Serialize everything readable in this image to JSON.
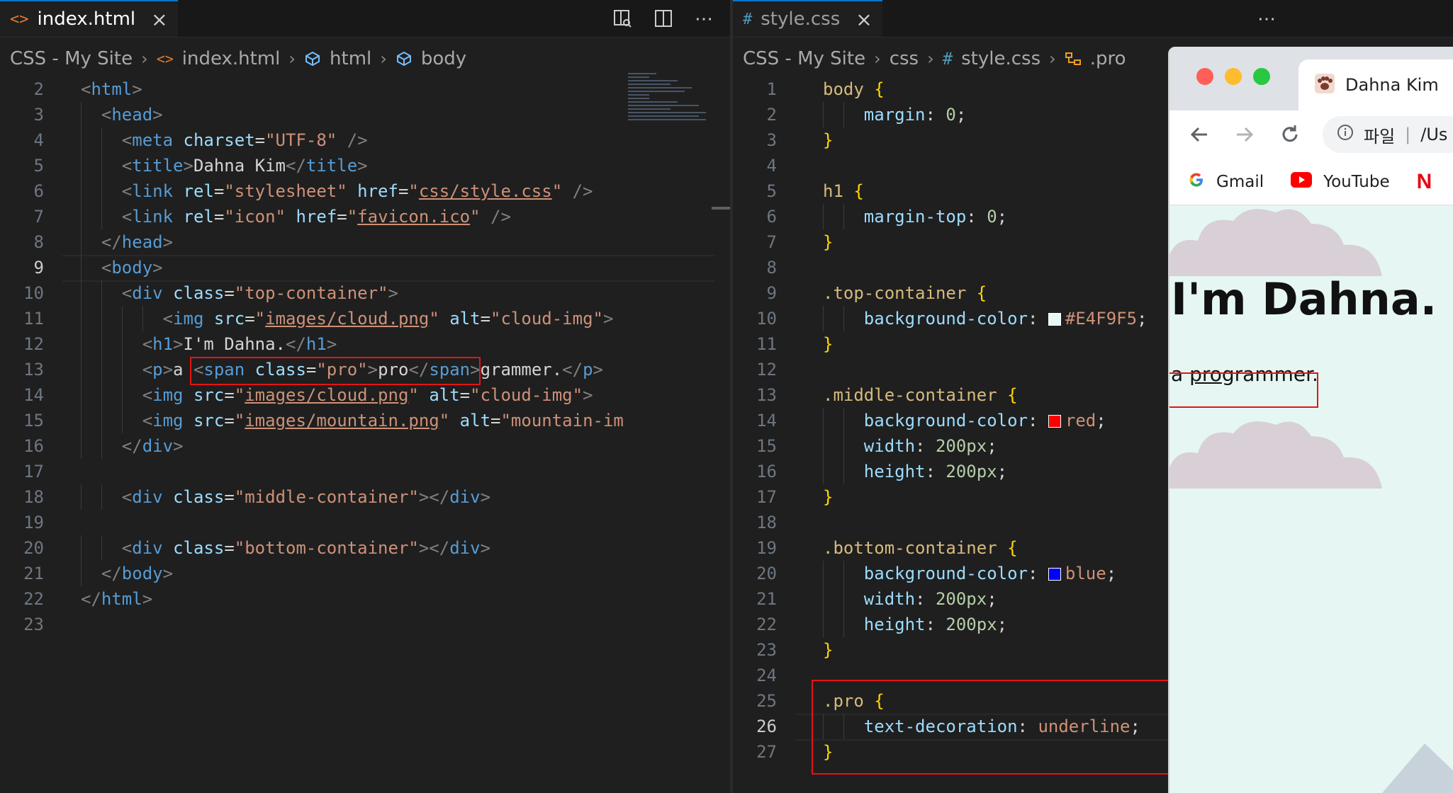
{
  "left_editor": {
    "tab": {
      "icon": "<>",
      "label": "index.html"
    },
    "breadcrumb": [
      "CSS - My Site",
      "index.html",
      "html",
      "body"
    ],
    "current_line": "9",
    "lines": [
      {
        "n": "2",
        "indent": 0,
        "tokens": [
          [
            "br",
            "<"
          ],
          [
            "tag",
            "html"
          ],
          [
            "br",
            ">"
          ]
        ]
      },
      {
        "n": "3",
        "indent": 1,
        "tokens": [
          [
            "br",
            "<"
          ],
          [
            "tag",
            "head"
          ],
          [
            "br",
            ">"
          ]
        ]
      },
      {
        "n": "4",
        "indent": 2,
        "tokens": [
          [
            "br",
            "<"
          ],
          [
            "tag",
            "meta"
          ],
          [
            "txt",
            " "
          ],
          [
            "attr",
            "charset"
          ],
          [
            "txt",
            "="
          ],
          [
            "str",
            "\"UTF-8\""
          ],
          [
            "txt",
            " "
          ],
          [
            "br",
            "/>"
          ]
        ]
      },
      {
        "n": "5",
        "indent": 2,
        "tokens": [
          [
            "br",
            "<"
          ],
          [
            "tag",
            "title"
          ],
          [
            "br",
            ">"
          ],
          [
            "txt",
            "Dahna Kim"
          ],
          [
            "br",
            "</"
          ],
          [
            "tag",
            "title"
          ],
          [
            "br",
            ">"
          ]
        ]
      },
      {
        "n": "6",
        "indent": 2,
        "tokens": [
          [
            "br",
            "<"
          ],
          [
            "tag",
            "link"
          ],
          [
            "txt",
            " "
          ],
          [
            "attr",
            "rel"
          ],
          [
            "txt",
            "="
          ],
          [
            "str",
            "\"stylesheet\""
          ],
          [
            "txt",
            " "
          ],
          [
            "attr",
            "href"
          ],
          [
            "txt",
            "="
          ],
          [
            "str",
            "\""
          ],
          [
            "link",
            "css/style.css"
          ],
          [
            "str",
            "\""
          ],
          [
            "txt",
            " "
          ],
          [
            "br",
            "/>"
          ]
        ]
      },
      {
        "n": "7",
        "indent": 2,
        "tokens": [
          [
            "br",
            "<"
          ],
          [
            "tag",
            "link"
          ],
          [
            "txt",
            " "
          ],
          [
            "attr",
            "rel"
          ],
          [
            "txt",
            "="
          ],
          [
            "str",
            "\"icon\""
          ],
          [
            "txt",
            " "
          ],
          [
            "attr",
            "href"
          ],
          [
            "txt",
            "="
          ],
          [
            "str",
            "\""
          ],
          [
            "link",
            "favicon.ico"
          ],
          [
            "str",
            "\""
          ],
          [
            "txt",
            " "
          ],
          [
            "br",
            "/>"
          ]
        ]
      },
      {
        "n": "8",
        "indent": 1,
        "tokens": [
          [
            "br",
            "</"
          ],
          [
            "tag",
            "head"
          ],
          [
            "br",
            ">"
          ]
        ]
      },
      {
        "n": "9",
        "indent": 1,
        "tokens": [
          [
            "br",
            "<"
          ],
          [
            "tag",
            "body"
          ],
          [
            "br",
            ">"
          ]
        ]
      },
      {
        "n": "10",
        "indent": 2,
        "tokens": [
          [
            "br",
            "<"
          ],
          [
            "tag",
            "div"
          ],
          [
            "txt",
            " "
          ],
          [
            "attr",
            "class"
          ],
          [
            "txt",
            "="
          ],
          [
            "str",
            "\"top-container\""
          ],
          [
            "br",
            ">"
          ]
        ]
      },
      {
        "n": "11",
        "indent": 4,
        "tokens": [
          [
            "br",
            "<"
          ],
          [
            "tag",
            "img"
          ],
          [
            "txt",
            " "
          ],
          [
            "attr",
            "src"
          ],
          [
            "txt",
            "="
          ],
          [
            "str",
            "\""
          ],
          [
            "link",
            "images/cloud.png"
          ],
          [
            "str",
            "\""
          ],
          [
            "txt",
            " "
          ],
          [
            "attr",
            "alt"
          ],
          [
            "txt",
            "="
          ],
          [
            "str",
            "\"cloud-img\""
          ],
          [
            "br",
            ">"
          ]
        ]
      },
      {
        "n": "12",
        "indent": 3,
        "tokens": [
          [
            "br",
            "<"
          ],
          [
            "tag",
            "h1"
          ],
          [
            "br",
            ">"
          ],
          [
            "txt",
            "I'm Dahna."
          ],
          [
            "br",
            "</"
          ],
          [
            "tag",
            "h1"
          ],
          [
            "br",
            ">"
          ]
        ]
      },
      {
        "n": "13",
        "indent": 3,
        "tokens": [
          [
            "br",
            "<"
          ],
          [
            "tag",
            "p"
          ],
          [
            "br",
            ">"
          ],
          [
            "txt",
            "a "
          ],
          [
            "br",
            "<"
          ],
          [
            "tag",
            "span"
          ],
          [
            "txt",
            " "
          ],
          [
            "attr",
            "class"
          ],
          [
            "txt",
            "="
          ],
          [
            "str",
            "\"pro\""
          ],
          [
            "br",
            ">"
          ],
          [
            "txt",
            "pro"
          ],
          [
            "br",
            "</"
          ],
          [
            "tag",
            "span"
          ],
          [
            "br",
            ">"
          ],
          [
            "txt",
            "grammer."
          ],
          [
            "br",
            "</"
          ],
          [
            "tag",
            "p"
          ],
          [
            "br",
            ">"
          ]
        ]
      },
      {
        "n": "14",
        "indent": 3,
        "tokens": [
          [
            "br",
            "<"
          ],
          [
            "tag",
            "img"
          ],
          [
            "txt",
            " "
          ],
          [
            "attr",
            "src"
          ],
          [
            "txt",
            "="
          ],
          [
            "str",
            "\""
          ],
          [
            "link",
            "images/cloud.png"
          ],
          [
            "str",
            "\""
          ],
          [
            "txt",
            " "
          ],
          [
            "attr",
            "alt"
          ],
          [
            "txt",
            "="
          ],
          [
            "str",
            "\"cloud-img\""
          ],
          [
            "br",
            ">"
          ]
        ]
      },
      {
        "n": "15",
        "indent": 3,
        "tokens": [
          [
            "br",
            "<"
          ],
          [
            "tag",
            "img"
          ],
          [
            "txt",
            " "
          ],
          [
            "attr",
            "src"
          ],
          [
            "txt",
            "="
          ],
          [
            "str",
            "\""
          ],
          [
            "link",
            "images/mountain.png"
          ],
          [
            "str",
            "\""
          ],
          [
            "txt",
            " "
          ],
          [
            "attr",
            "alt"
          ],
          [
            "txt",
            "="
          ],
          [
            "str",
            "\"mountain-im"
          ]
        ]
      },
      {
        "n": "16",
        "indent": 2,
        "tokens": [
          [
            "br",
            "</"
          ],
          [
            "tag",
            "div"
          ],
          [
            "br",
            ">"
          ]
        ]
      },
      {
        "n": "17",
        "indent": 0,
        "tokens": []
      },
      {
        "n": "18",
        "indent": 2,
        "tokens": [
          [
            "br",
            "<"
          ],
          [
            "tag",
            "div"
          ],
          [
            "txt",
            " "
          ],
          [
            "attr",
            "class"
          ],
          [
            "txt",
            "="
          ],
          [
            "str",
            "\"middle-container\""
          ],
          [
            "br",
            "></"
          ],
          [
            "tag",
            "div"
          ],
          [
            "br",
            ">"
          ]
        ]
      },
      {
        "n": "19",
        "indent": 0,
        "tokens": []
      },
      {
        "n": "20",
        "indent": 2,
        "tokens": [
          [
            "br",
            "<"
          ],
          [
            "tag",
            "div"
          ],
          [
            "txt",
            " "
          ],
          [
            "attr",
            "class"
          ],
          [
            "txt",
            "="
          ],
          [
            "str",
            "\"bottom-container\""
          ],
          [
            "br",
            "></"
          ],
          [
            "tag",
            "div"
          ],
          [
            "br",
            ">"
          ]
        ]
      },
      {
        "n": "21",
        "indent": 1,
        "tokens": [
          [
            "br",
            "</"
          ],
          [
            "tag",
            "body"
          ],
          [
            "br",
            ">"
          ]
        ]
      },
      {
        "n": "22",
        "indent": 0,
        "tokens": [
          [
            "br",
            "</"
          ],
          [
            "tag",
            "html"
          ],
          [
            "br",
            ">"
          ]
        ]
      },
      {
        "n": "23",
        "indent": 0,
        "tokens": []
      }
    ]
  },
  "right_editor": {
    "tab": {
      "icon": "#",
      "label": "style.css"
    },
    "breadcrumb": [
      "CSS - My Site",
      "css",
      "style.css",
      ".pro"
    ],
    "current_line": "26",
    "lines": [
      {
        "n": "1",
        "indent": 0,
        "tokens": [
          [
            "sel",
            "body"
          ],
          [
            "txt",
            " "
          ],
          [
            "brace",
            "{"
          ]
        ]
      },
      {
        "n": "2",
        "indent": 2,
        "tokens": [
          [
            "prop",
            "margin"
          ],
          [
            "txt",
            ": "
          ],
          [
            "num",
            "0"
          ],
          [
            "txt",
            ";"
          ]
        ]
      },
      {
        "n": "3",
        "indent": 0,
        "tokens": [
          [
            "brace",
            "}"
          ]
        ]
      },
      {
        "n": "4",
        "indent": 0,
        "tokens": []
      },
      {
        "n": "5",
        "indent": 0,
        "tokens": [
          [
            "sel",
            "h1"
          ],
          [
            "txt",
            " "
          ],
          [
            "brace",
            "{"
          ]
        ]
      },
      {
        "n": "6",
        "indent": 2,
        "tokens": [
          [
            "prop",
            "margin-top"
          ],
          [
            "txt",
            ": "
          ],
          [
            "num",
            "0"
          ],
          [
            "txt",
            ";"
          ]
        ]
      },
      {
        "n": "7",
        "indent": 0,
        "tokens": [
          [
            "brace",
            "}"
          ]
        ]
      },
      {
        "n": "8",
        "indent": 0,
        "tokens": []
      },
      {
        "n": "9",
        "indent": 0,
        "tokens": [
          [
            "sel",
            ".top-container"
          ],
          [
            "txt",
            " "
          ],
          [
            "brace",
            "{"
          ]
        ]
      },
      {
        "n": "10",
        "indent": 2,
        "tokens": [
          [
            "prop",
            "background-color"
          ],
          [
            "txt",
            ": "
          ],
          [
            "swatch",
            "#E4F9F5"
          ],
          [
            "str",
            "#E4F9F5"
          ],
          [
            "txt",
            ";"
          ]
        ]
      },
      {
        "n": "11",
        "indent": 0,
        "tokens": [
          [
            "brace",
            "}"
          ]
        ]
      },
      {
        "n": "12",
        "indent": 0,
        "tokens": []
      },
      {
        "n": "13",
        "indent": 0,
        "tokens": [
          [
            "sel",
            ".middle-container"
          ],
          [
            "txt",
            " "
          ],
          [
            "brace",
            "{"
          ]
        ]
      },
      {
        "n": "14",
        "indent": 2,
        "tokens": [
          [
            "prop",
            "background-color"
          ],
          [
            "txt",
            ": "
          ],
          [
            "swatch",
            "red"
          ],
          [
            "str",
            "red"
          ],
          [
            "txt",
            ";"
          ]
        ]
      },
      {
        "n": "15",
        "indent": 2,
        "tokens": [
          [
            "prop",
            "width"
          ],
          [
            "txt",
            ": "
          ],
          [
            "num",
            "200px"
          ],
          [
            "txt",
            ";"
          ]
        ]
      },
      {
        "n": "16",
        "indent": 2,
        "tokens": [
          [
            "prop",
            "height"
          ],
          [
            "txt",
            ": "
          ],
          [
            "num",
            "200px"
          ],
          [
            "txt",
            ";"
          ]
        ]
      },
      {
        "n": "17",
        "indent": 0,
        "tokens": [
          [
            "brace",
            "}"
          ]
        ]
      },
      {
        "n": "18",
        "indent": 0,
        "tokens": []
      },
      {
        "n": "19",
        "indent": 0,
        "tokens": [
          [
            "sel",
            ".bottom-container"
          ],
          [
            "txt",
            " "
          ],
          [
            "brace",
            "{"
          ]
        ]
      },
      {
        "n": "20",
        "indent": 2,
        "tokens": [
          [
            "prop",
            "background-color"
          ],
          [
            "txt",
            ": "
          ],
          [
            "swatch",
            "blue"
          ],
          [
            "str",
            "blue"
          ],
          [
            "txt",
            ";"
          ]
        ]
      },
      {
        "n": "21",
        "indent": 2,
        "tokens": [
          [
            "prop",
            "width"
          ],
          [
            "txt",
            ": "
          ],
          [
            "num",
            "200px"
          ],
          [
            "txt",
            ";"
          ]
        ]
      },
      {
        "n": "22",
        "indent": 2,
        "tokens": [
          [
            "prop",
            "height"
          ],
          [
            "txt",
            ": "
          ],
          [
            "num",
            "200px"
          ],
          [
            "txt",
            ";"
          ]
        ]
      },
      {
        "n": "23",
        "indent": 0,
        "tokens": [
          [
            "brace",
            "}"
          ]
        ]
      },
      {
        "n": "24",
        "indent": 0,
        "tokens": []
      },
      {
        "n": "25",
        "indent": 0,
        "tokens": [
          [
            "sel",
            ".pro"
          ],
          [
            "txt",
            " "
          ],
          [
            "brace",
            "{"
          ]
        ]
      },
      {
        "n": "26",
        "indent": 2,
        "tokens": [
          [
            "prop",
            "text-decoration"
          ],
          [
            "txt",
            ": "
          ],
          [
            "str",
            "underline"
          ],
          [
            "txt",
            ";"
          ]
        ]
      },
      {
        "n": "27",
        "indent": 0,
        "tokens": [
          [
            "brace",
            "}"
          ]
        ]
      }
    ]
  },
  "browser": {
    "tab_title": "Dahna Kim",
    "omnibox_prefix": "파일",
    "omnibox_text": "/Us",
    "bookmarks": [
      "Gmail",
      "YouTube"
    ],
    "page": {
      "h1": "I'm Dahna.",
      "p_before": "a ",
      "p_span": "pro",
      "p_after": "grammer.",
      "background": "#E4F9F5"
    }
  },
  "colors": {
    "editor_bg": "#1f1f1f",
    "tag": "#569cd6",
    "attr": "#9cdcfe",
    "string": "#ce9178",
    "selector": "#d7ba7d",
    "number": "#b5cea8",
    "annotation_red": "#e51414"
  }
}
